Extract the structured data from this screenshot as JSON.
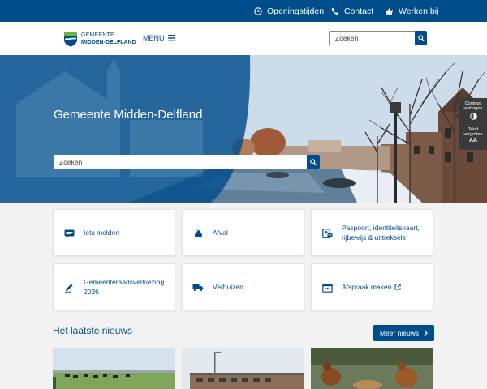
{
  "topbar": {
    "links": [
      {
        "label": "Openingstijden",
        "icon": "clock-icon"
      },
      {
        "label": "Contact",
        "icon": "phone-icon"
      },
      {
        "label": "Werken bij",
        "icon": "crown-icon"
      }
    ]
  },
  "header": {
    "logo_line1": "GEMEENTE",
    "logo_line2": "MIDDEN-DELFLAND",
    "menu_label": "MENU",
    "search_placeholder": "Zoeken"
  },
  "hero": {
    "title": "Gemeente Midden-Delfland",
    "search_placeholder": "Zoeken"
  },
  "accessibility": {
    "contrast_label": "Contrast verhogen",
    "text_label": "Tekst vergroten",
    "text_glyph": "AA"
  },
  "tiles": [
    {
      "label": "Iets melden",
      "icon": "message-icon"
    },
    {
      "label": "Afval",
      "icon": "trash-bag-icon"
    },
    {
      "label": "Paspoort, identiteitskaart, rijbewijs & uittreksels",
      "icon": "id-card-icon"
    },
    {
      "label": "Gemeenteraadsverkiezing 2026",
      "icon": "pen-icon"
    },
    {
      "label": "Verhuizen",
      "icon": "truck-icon"
    },
    {
      "label": "Afspraak maken",
      "icon": "calendar-icon"
    }
  ],
  "news": {
    "title": "Het laatste nieuws",
    "more_label": "Meer nieuws"
  },
  "colors": {
    "brand_blue": "#004d8c",
    "background": "#f2f2f2",
    "panel_dark": "#3a3a3a"
  }
}
